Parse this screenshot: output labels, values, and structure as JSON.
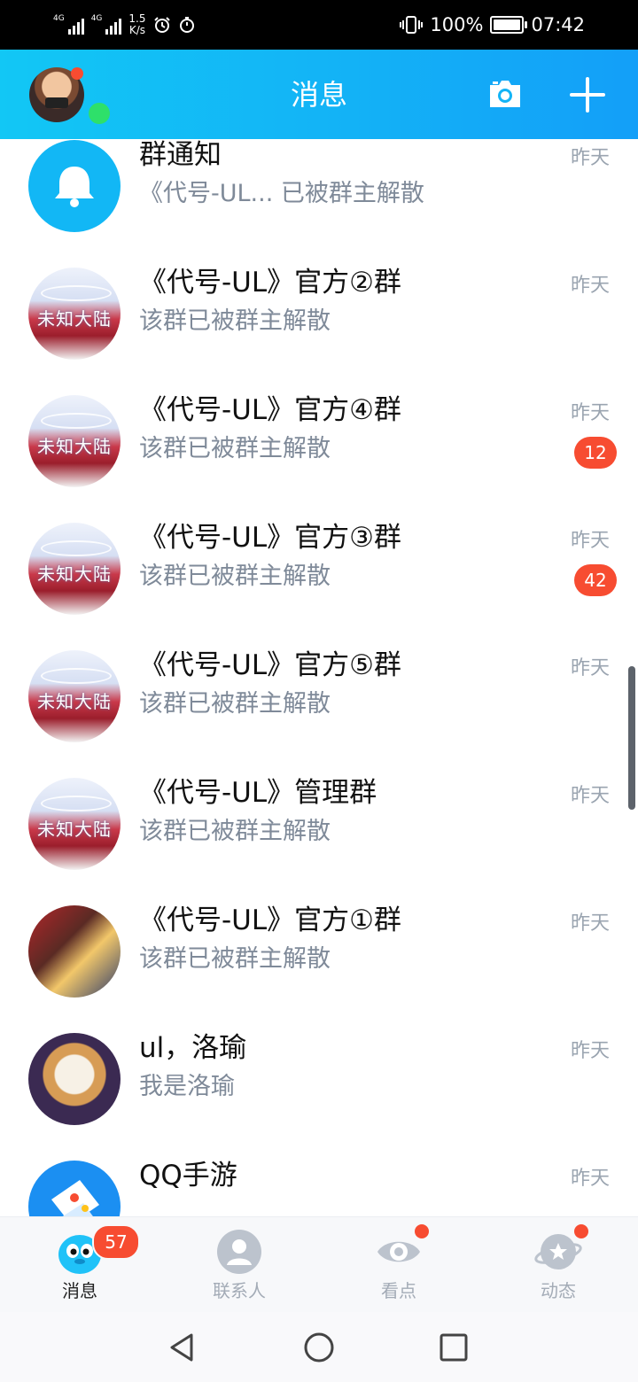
{
  "status_bar": {
    "network_1": "4G",
    "network_2": "4G",
    "speed_value": "1.5",
    "speed_unit": "K/s",
    "battery": "100%",
    "time": "07:42"
  },
  "header": {
    "title": "消息"
  },
  "conversations": [
    {
      "name": "群通知",
      "preview": "《代号-UL... 已被群主解散",
      "time": "昨天",
      "badge": ""
    },
    {
      "name": "《代号-UL》官方②群",
      "preview": "该群已被群主解散",
      "time": "昨天",
      "badge": ""
    },
    {
      "name": "《代号-UL》官方④群",
      "preview": "该群已被群主解散",
      "time": "昨天",
      "badge": "12"
    },
    {
      "name": "《代号-UL》官方③群",
      "preview": "该群已被群主解散",
      "time": "昨天",
      "badge": "42"
    },
    {
      "name": "《代号-UL》官方⑤群",
      "preview": "该群已被群主解散",
      "time": "昨天",
      "badge": ""
    },
    {
      "name": "《代号-UL》管理群",
      "preview": "该群已被群主解散",
      "time": "昨天",
      "badge": ""
    },
    {
      "name": "《代号-UL》官方①群",
      "preview": "该群已被群主解散",
      "time": "昨天",
      "badge": ""
    },
    {
      "name": "ul，洛瑜",
      "preview": "我是洛瑜",
      "time": "昨天",
      "badge": ""
    },
    {
      "name": "QQ手游",
      "preview": "",
      "time": "昨天",
      "badge": ""
    }
  ],
  "avatar_logo_text": "未知大陆",
  "bottom_nav": {
    "tabs": [
      {
        "label": "消息",
        "badge": "57",
        "icon": "qq-penguin-icon"
      },
      {
        "label": "联系人",
        "icon": "contacts-icon"
      },
      {
        "label": "看点",
        "icon": "eye-icon"
      },
      {
        "label": "动态",
        "icon": "planet-icon"
      }
    ]
  },
  "colors": {
    "header_gradient_start": "#12c7f5",
    "header_gradient_end": "#139ff8",
    "badge_red": "#f74c31",
    "preview_gray": "#7f8a99"
  }
}
